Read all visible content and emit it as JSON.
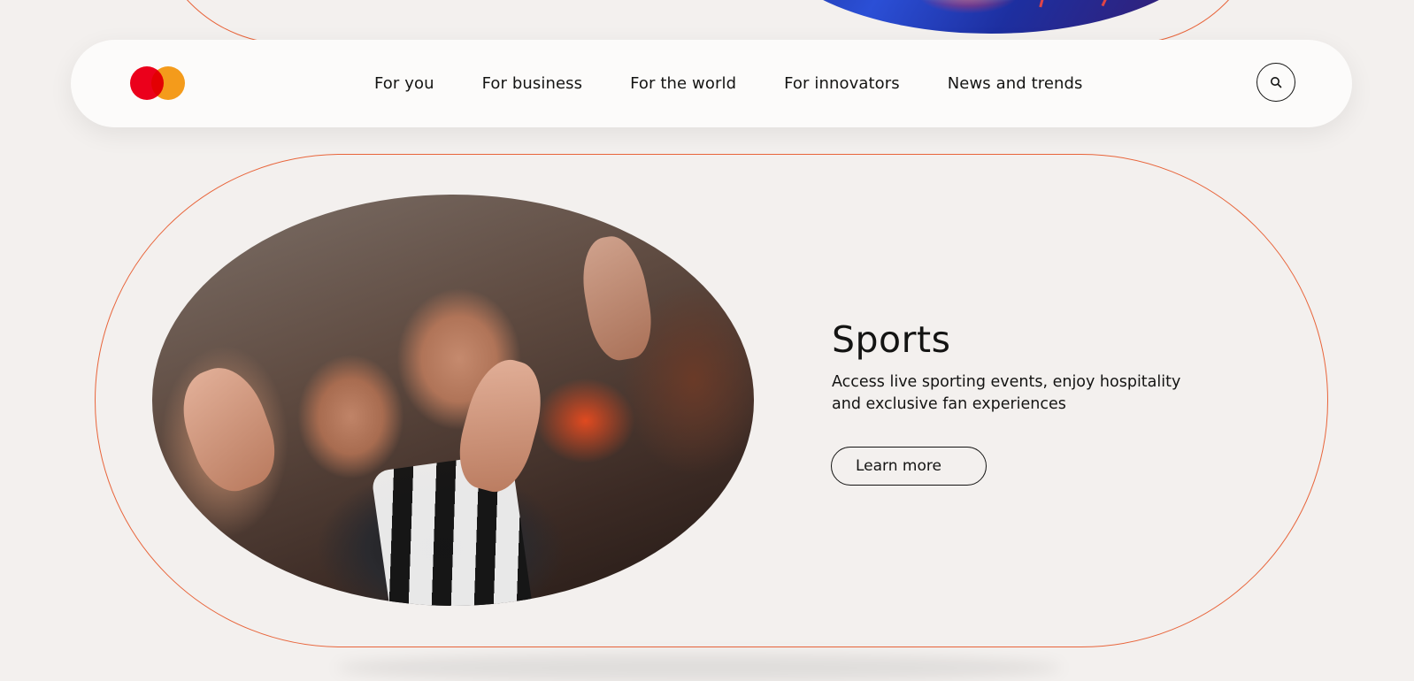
{
  "brand": {
    "logo_colors": {
      "red": "#eb001b",
      "orange": "#f79e1b"
    },
    "accent": "#e8643a"
  },
  "nav": {
    "items": [
      {
        "label": "For you"
      },
      {
        "label": "For business"
      },
      {
        "label": "For the world"
      },
      {
        "label": "For innovators"
      },
      {
        "label": "News and trends"
      }
    ],
    "search_icon": "search-icon"
  },
  "feature": {
    "title": "Sports",
    "description": "Access live sporting events, enjoy hospitality and exclusive fan experiences",
    "cta_label": "Learn more"
  }
}
